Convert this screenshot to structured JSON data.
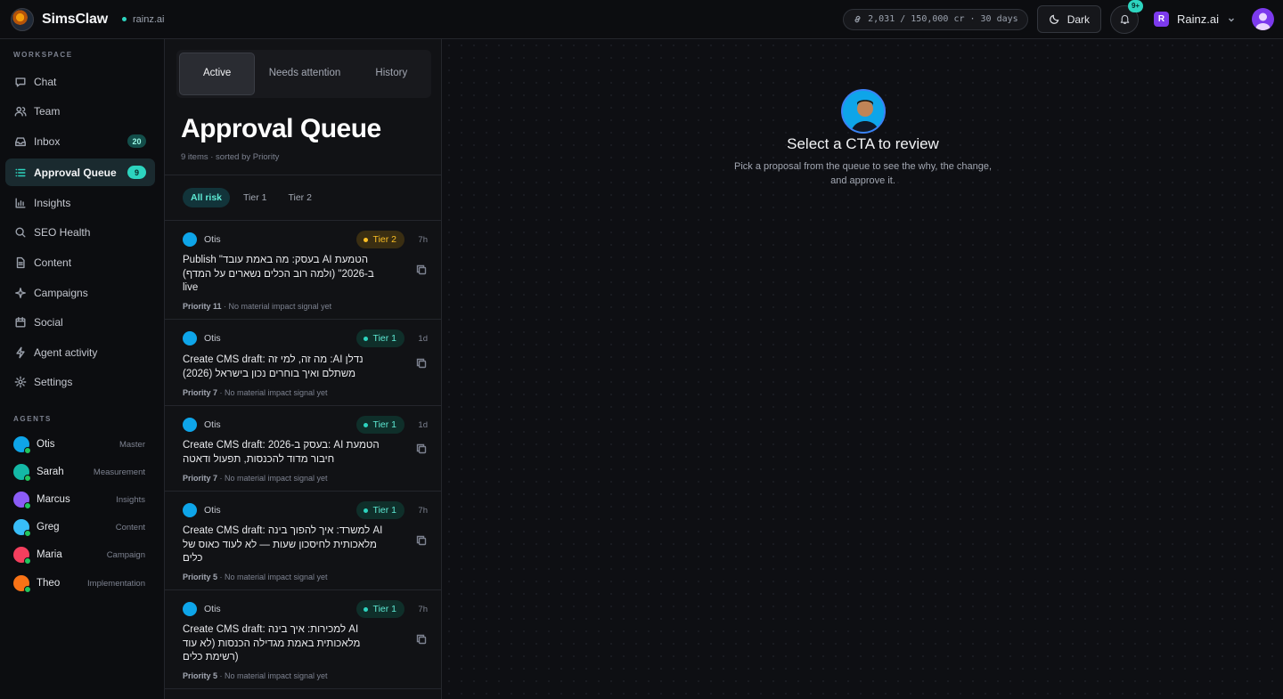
{
  "app": {
    "brand": "SimsClaw",
    "workspace": "rainz.ai"
  },
  "topbar": {
    "credits": "2,031 / 150,000 cr · 30 days",
    "theme_label": "Dark",
    "notifications_badge": "9+",
    "org_name": "Rainz.ai",
    "org_initial": "R"
  },
  "sidebar": {
    "workspace_label": "WORKSPACE",
    "items": [
      {
        "label": "Chat",
        "icon": "chat-icon"
      },
      {
        "label": "Team",
        "icon": "team-icon"
      },
      {
        "label": "Inbox",
        "icon": "inbox-icon",
        "badge": "20"
      },
      {
        "label": "Approval Queue",
        "icon": "list-icon",
        "badge": "9",
        "active": true
      },
      {
        "label": "Insights",
        "icon": "bar-chart-icon"
      },
      {
        "label": "SEO Health",
        "icon": "search-icon"
      },
      {
        "label": "Content",
        "icon": "document-icon"
      },
      {
        "label": "Campaigns",
        "icon": "sparkle-icon"
      },
      {
        "label": "Social",
        "icon": "calendar-icon"
      },
      {
        "label": "Agent activity",
        "icon": "bolt-icon"
      },
      {
        "label": "Settings",
        "icon": "gear-icon"
      }
    ],
    "agents_label": "AGENTS",
    "agents": [
      {
        "name": "Otis",
        "role": "Master"
      },
      {
        "name": "Sarah",
        "role": "Measurement"
      },
      {
        "name": "Marcus",
        "role": "Insights"
      },
      {
        "name": "Greg",
        "role": "Content"
      },
      {
        "name": "Maria",
        "role": "Campaign"
      },
      {
        "name": "Theo",
        "role": "Implementation"
      }
    ]
  },
  "queue": {
    "tabs": [
      "Active",
      "Needs attention",
      "History"
    ],
    "title": "Approval Queue",
    "subtitle": "9 items · sorted by Priority",
    "filters": [
      "All risk",
      "Tier 1",
      "Tier 2"
    ],
    "items": [
      {
        "agent": "Otis",
        "tier": "Tier 2",
        "age": "7h",
        "lines": [
          "Publish \"בעסק: מה באמת עובד AI הטמעת",
          "ב-2026\" (ולמה רוב הכלים נשארים על המדף)",
          "live"
        ],
        "priority": "Priority 11",
        "impact": " · No material impact signal yet"
      },
      {
        "agent": "Otis",
        "tier": "Tier 1",
        "age": "1d",
        "lines": [
          "Create CMS draft: מה זה, למי זה :AI נדלן",
          "משתלם ואיך בוחרים נכון בישראל (2026)"
        ],
        "priority": "Priority 7",
        "impact": " · No material impact signal yet"
      },
      {
        "agent": "Otis",
        "tier": "Tier 1",
        "age": "1d",
        "lines": [
          "Create CMS draft: בעסק ב-2026: AI הטמעת",
          "חיבור מדוד להכנסות, תפעול ודאטה"
        ],
        "priority": "Priority 7",
        "impact": " · No material impact signal yet"
      },
      {
        "agent": "Otis",
        "tier": "Tier 1",
        "age": "7h",
        "lines": [
          "Create CMS draft: למשרד: איך להפוך בינה AI",
          "מלאכותית לחיסכון שעות — לא לעוד כאוס של",
          "כלים"
        ],
        "priority": "Priority 5",
        "impact": " · No material impact signal yet"
      },
      {
        "agent": "Otis",
        "tier": "Tier 1",
        "age": "7h",
        "lines": [
          "Create CMS draft: למכירות: איך בינה AI",
          "מלאכותית באמת מגדילה הכנסות (לא עוד",
          "רשימת כלים)"
        ],
        "priority": "Priority 5",
        "impact": " · No material impact signal yet"
      }
    ]
  },
  "detail": {
    "title": "Select a CTA to review",
    "subtitle": "Pick a proposal from the queue to see the why, the change, and approve it."
  },
  "colors": {
    "accent": "#2dd4bf",
    "tier1": "#5eead4",
    "tier2": "#fbbf24",
    "org": "#7c3aed"
  }
}
